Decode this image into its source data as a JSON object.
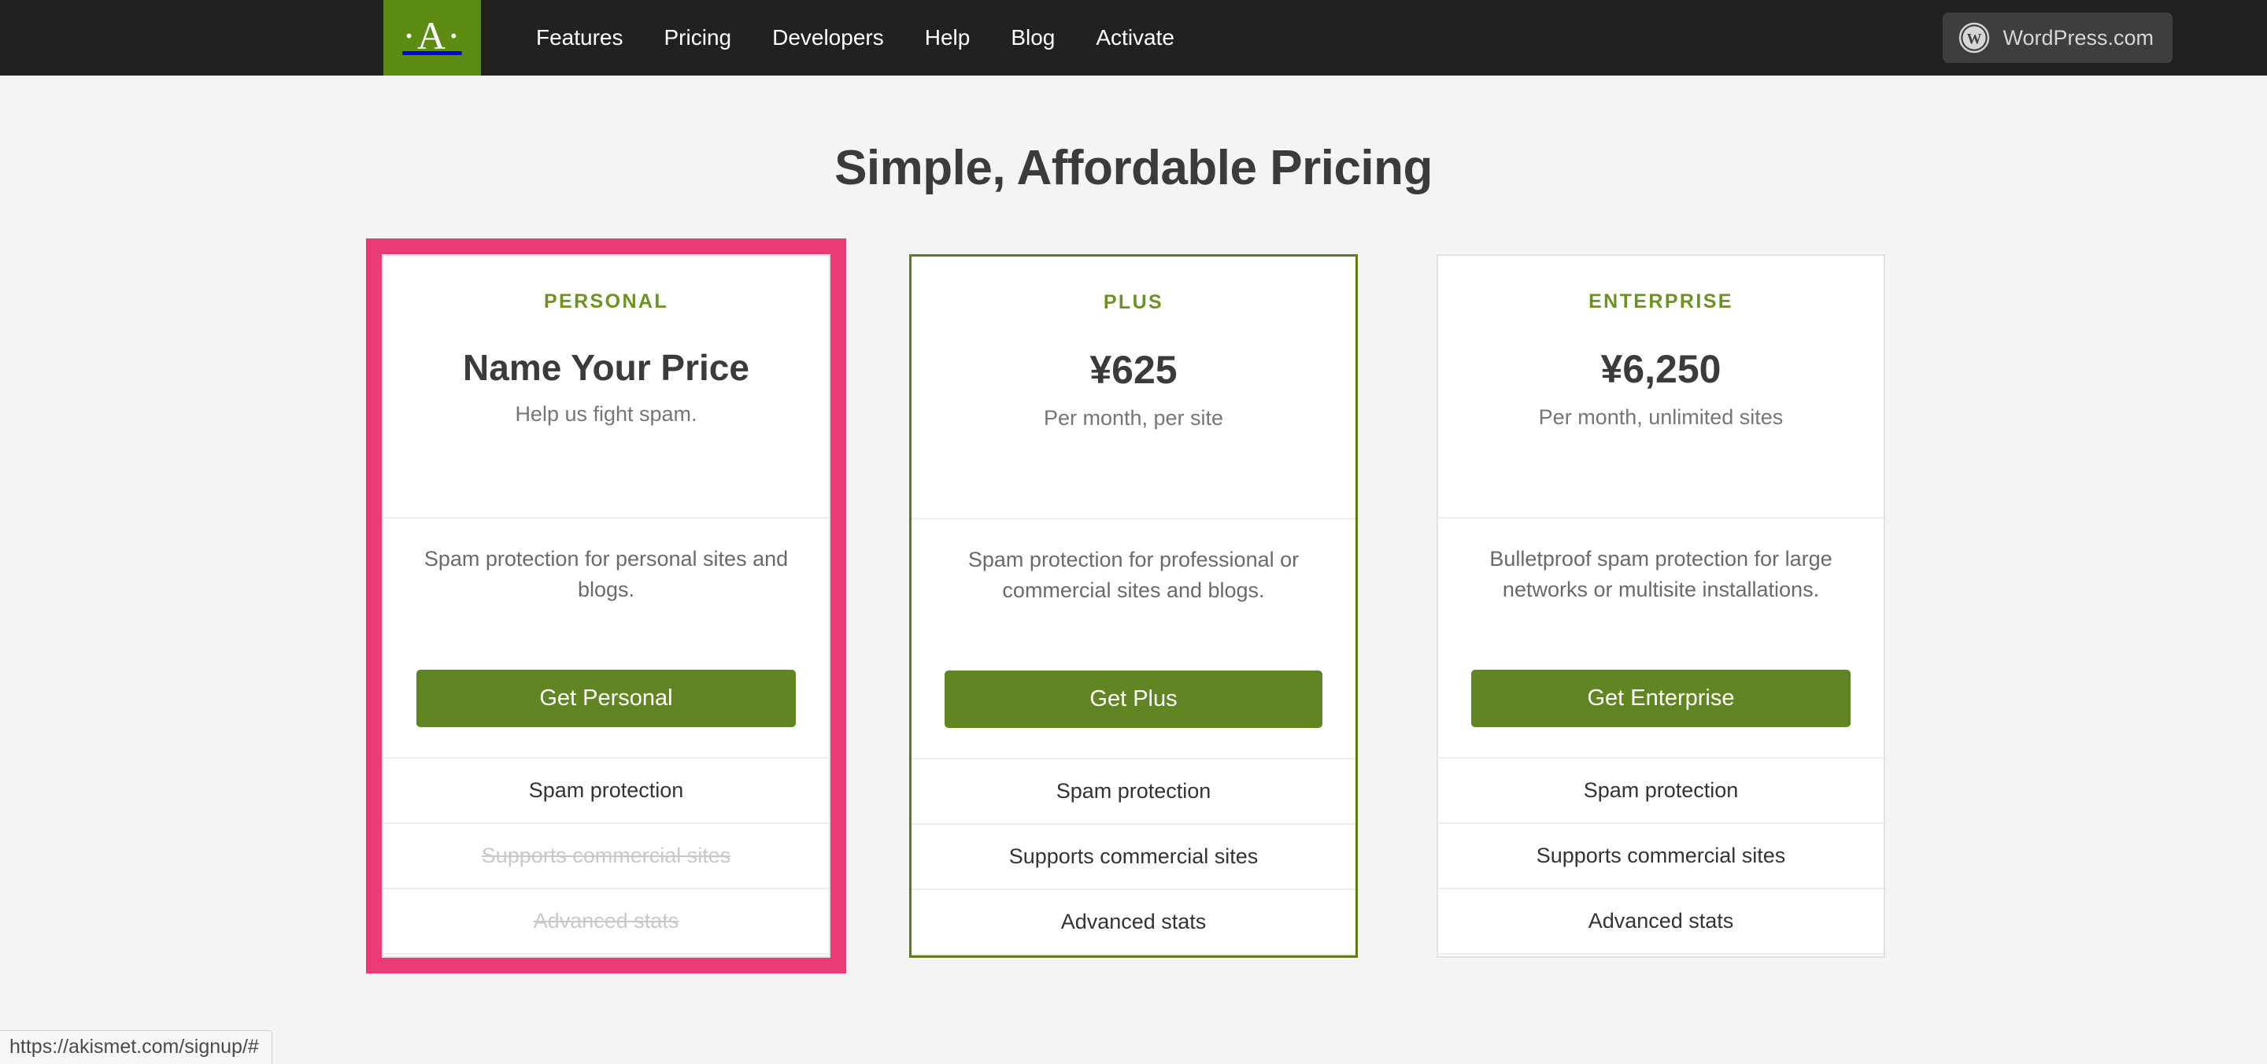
{
  "nav": {
    "logo_glyph": "·A·",
    "logo_name": "akismet-logo",
    "links": [
      {
        "label": "Features"
      },
      {
        "label": "Pricing"
      },
      {
        "label": "Developers"
      },
      {
        "label": "Help"
      },
      {
        "label": "Blog"
      },
      {
        "label": "Activate"
      }
    ],
    "wordpress_button": {
      "label": "WordPress.com",
      "icon": "wordpress-icon"
    },
    "bg_color": "#21211f",
    "logo_bg_color": "#5c8c13"
  },
  "heading": {
    "title": "Simple, Affordable Pricing"
  },
  "colors": {
    "brand_green": "#5c8c13",
    "button_green": "#628523",
    "plan_label_green": "#6d9122",
    "highlight_pink": "#eb3a78",
    "page_bg": "#f4f4f4"
  },
  "plans": [
    {
      "name": "PERSONAL",
      "price": "Name Your Price",
      "price_is_text": true,
      "period": "Help us fight spam.",
      "description": "Spam protection for personal sites and blogs.",
      "cta": "Get Personal",
      "highlighted": true,
      "accent_border": false,
      "features": [
        {
          "label": "Spam protection",
          "included": true
        },
        {
          "label": "Supports commercial sites",
          "included": false
        },
        {
          "label": "Advanced stats",
          "included": false
        }
      ]
    },
    {
      "name": "PLUS",
      "price": "¥625",
      "price_is_text": false,
      "period": "Per month, per site",
      "description": "Spam protection for professional or commercial sites and blogs.",
      "cta": "Get Plus",
      "highlighted": false,
      "accent_border": true,
      "features": [
        {
          "label": "Spam protection",
          "included": true
        },
        {
          "label": "Supports commercial sites",
          "included": true
        },
        {
          "label": "Advanced stats",
          "included": true
        }
      ]
    },
    {
      "name": "ENTERPRISE",
      "price": "¥6,250",
      "price_is_text": false,
      "period": "Per month, unlimited sites",
      "description": "Bulletproof spam protection for large networks or multisite installations.",
      "cta": "Get Enterprise",
      "highlighted": false,
      "accent_border": false,
      "features": [
        {
          "label": "Spam protection",
          "included": true
        },
        {
          "label": "Supports commercial sites",
          "included": true
        },
        {
          "label": "Advanced stats",
          "included": true
        }
      ]
    }
  ],
  "status_bar": {
    "url": "https://akismet.com/signup/#"
  }
}
